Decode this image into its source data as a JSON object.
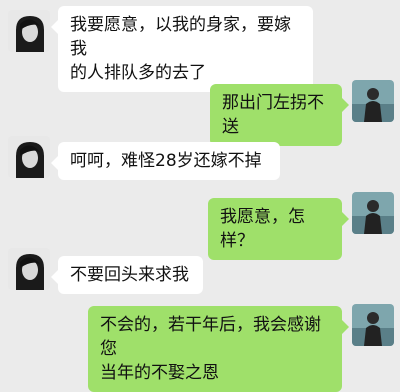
{
  "colors": {
    "background": "#ebebeb",
    "incoming_bubble": "#ffffff",
    "outgoing_bubble": "#9fe06a"
  },
  "avatars": {
    "incoming": "female-avatar-icon",
    "outgoing": "male-avatar-icon"
  },
  "messages": [
    {
      "side": "left",
      "lines": [
        "我要愿意，以我的身家，要嫁我",
        "的人排队多的去了"
      ]
    },
    {
      "side": "right",
      "lines": [
        "那出门左拐不送"
      ]
    },
    {
      "side": "left",
      "lines": [
        "呵呵，难怪28岁还嫁不掉"
      ]
    },
    {
      "side": "right",
      "lines": [
        "我愿意，怎样？"
      ]
    },
    {
      "side": "left",
      "lines": [
        "不要回头来求我"
      ]
    },
    {
      "side": "right",
      "lines": [
        "不会的，若干年后，我会感谢您",
        "当年的不娶之恩"
      ]
    }
  ]
}
